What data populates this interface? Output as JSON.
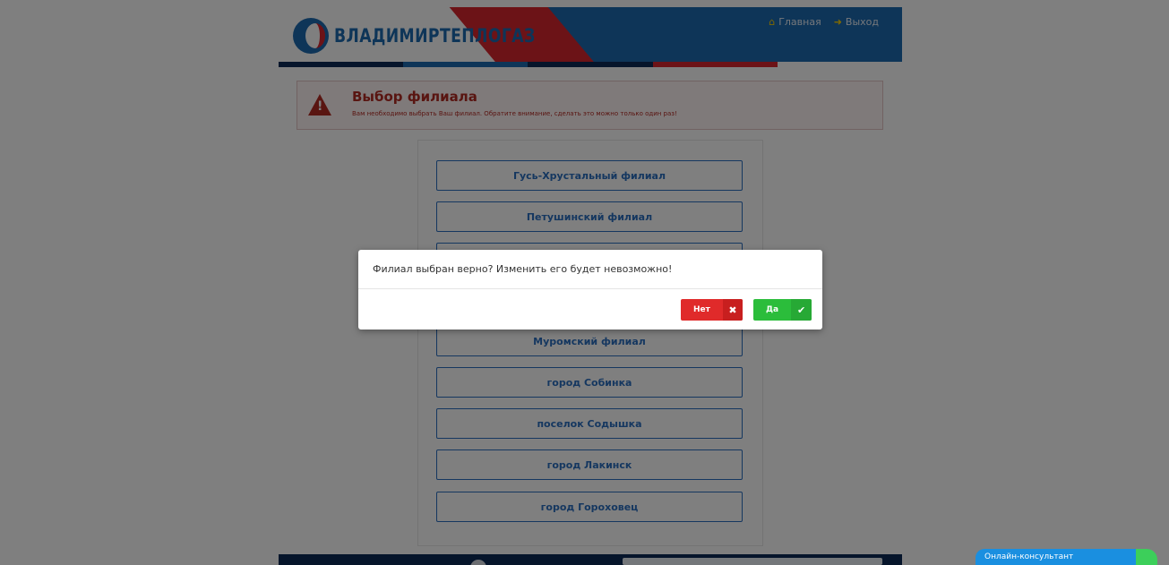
{
  "header": {
    "logo_text": "ВЛАДИМИРТЕПЛОГАЗ",
    "nav": [
      {
        "label": "Главная",
        "icon": "home-icon"
      },
      {
        "label": "Выход",
        "icon": "logout-icon"
      }
    ],
    "stripe_colors": [
      "#0c2b57",
      "#1d6bb0",
      "#0c2b57",
      "#d9262e",
      "#ffffff"
    ]
  },
  "alert": {
    "title": "Выбор филиала",
    "text": "Вам необходимо выбрать Ваш филиал. Обратите внимание, сделать это можно только один раз!"
  },
  "branches": [
    "Гусь-Хрустальный филиал",
    "Петушинский филиал",
    "",
    "",
    "Муромский филиал",
    "город Собинка",
    "поселок Содышка",
    "город Лакинск",
    "город Гороховец"
  ],
  "modal": {
    "message": "Филиал выбран верно? Изменить его будет невозможно!",
    "no_label": "Нет",
    "yes_label": "Да"
  },
  "consultant": {
    "label": "Онлайн-консультант"
  },
  "colors": {
    "brand_blue": "#1d6bb0",
    "brand_red": "#d9262e",
    "no_button": "#e02a2a",
    "yes_button": "#2bbd3b"
  }
}
